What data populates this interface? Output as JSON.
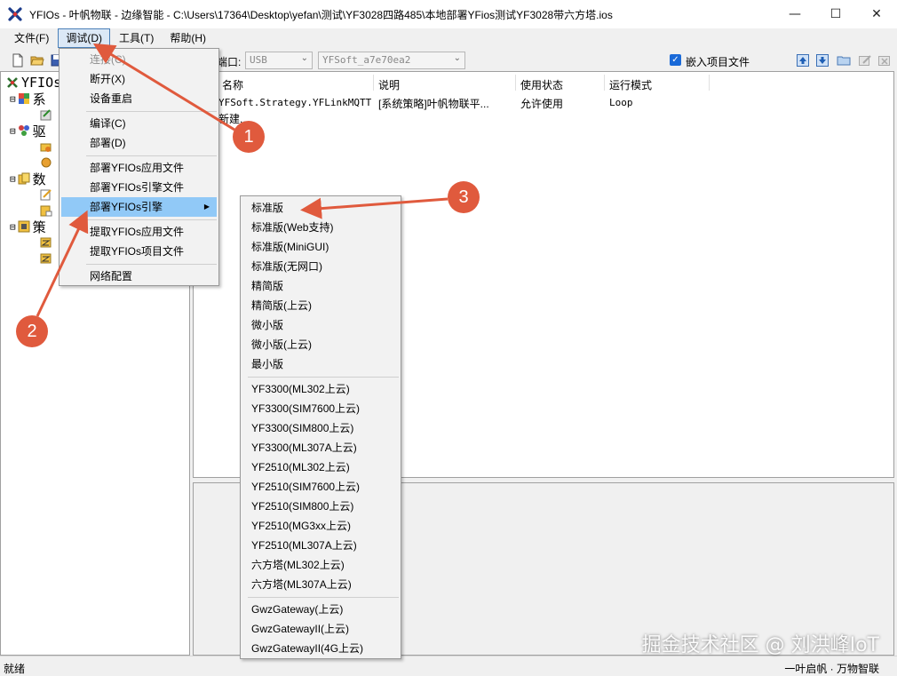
{
  "window": {
    "title": "YFIOs - 叶帆物联 - 边缘智能 - C:\\Users\\17364\\Desktop\\yefan\\测试\\YF3028四路485\\本地部署YFios测试YF3028带六方塔.ios",
    "minimize": "—",
    "maximize": "☐",
    "close": "✕"
  },
  "menubar": [
    "文件(F)",
    "调试(D)",
    "工具(T)",
    "帮助(H)"
  ],
  "toolbar": {
    "port_label": "端口:",
    "port_value": "USB",
    "device_value": "YFSoft_a7e70ea2",
    "embed_label": "嵌入项目文件",
    "embed_checked": true
  },
  "tree": {
    "root": "YFIOs",
    "nodes": [
      "系",
      "驱",
      "数",
      "策"
    ]
  },
  "list": {
    "columns": [
      "名称",
      "说明",
      "使用状态",
      "运行模式"
    ],
    "rows": [
      {
        "name": "YFSoft.Strategy.YFLinkMQTT",
        "desc": "[系统策略]叶帆物联平...",
        "status": "允许使用",
        "mode": "Loop"
      },
      {
        "name": "新建...",
        "desc": "",
        "status": "",
        "mode": ""
      }
    ]
  },
  "debug_menu": {
    "items": [
      {
        "label": "连接(C)",
        "disabled": true
      },
      {
        "label": "断开(X)"
      },
      {
        "label": "设备重启"
      },
      {
        "label": "编译(C)"
      },
      {
        "label": "部署(D)"
      },
      {
        "label": "部署YFIOs应用文件"
      },
      {
        "label": "部署YFIOs引擎文件"
      },
      {
        "label": "部署YFIOs引擎",
        "highlight": true,
        "submenu_arrow": "▶"
      },
      {
        "label": "提取YFIOs应用文件"
      },
      {
        "label": "提取YFIOs项目文件"
      },
      {
        "label": "网络配置"
      }
    ]
  },
  "engine_submenu": {
    "items": [
      "标准版",
      "标准版(Web支持)",
      "标准版(MiniGUI)",
      "标准版(无网口)",
      "精简版",
      "精简版(上云)",
      "微小版",
      "微小版(上云)",
      "最小版",
      "YF3300(ML302上云)",
      "YF3300(SIM7600上云)",
      "YF3300(SIM800上云)",
      "YF3300(ML307A上云)",
      "YF2510(ML302上云)",
      "YF2510(SIM7600上云)",
      "YF2510(SIM800上云)",
      "YF2510(MG3xx上云)",
      "YF2510(ML307A上云)",
      "六方塔(ML302上云)",
      "六方塔(ML307A上云)",
      "GwzGateway(上云)",
      "GwzGatewayII(上云)",
      "GwzGatewayII(4G上云)"
    ]
  },
  "annotations": [
    "1",
    "2",
    "3"
  ],
  "annotation_color": "#e05a3d",
  "status": {
    "left": "就绪",
    "right": "一叶启帆 · 万物智联"
  },
  "watermark": "掘金技术社区 @ 刘洪峰IoT"
}
